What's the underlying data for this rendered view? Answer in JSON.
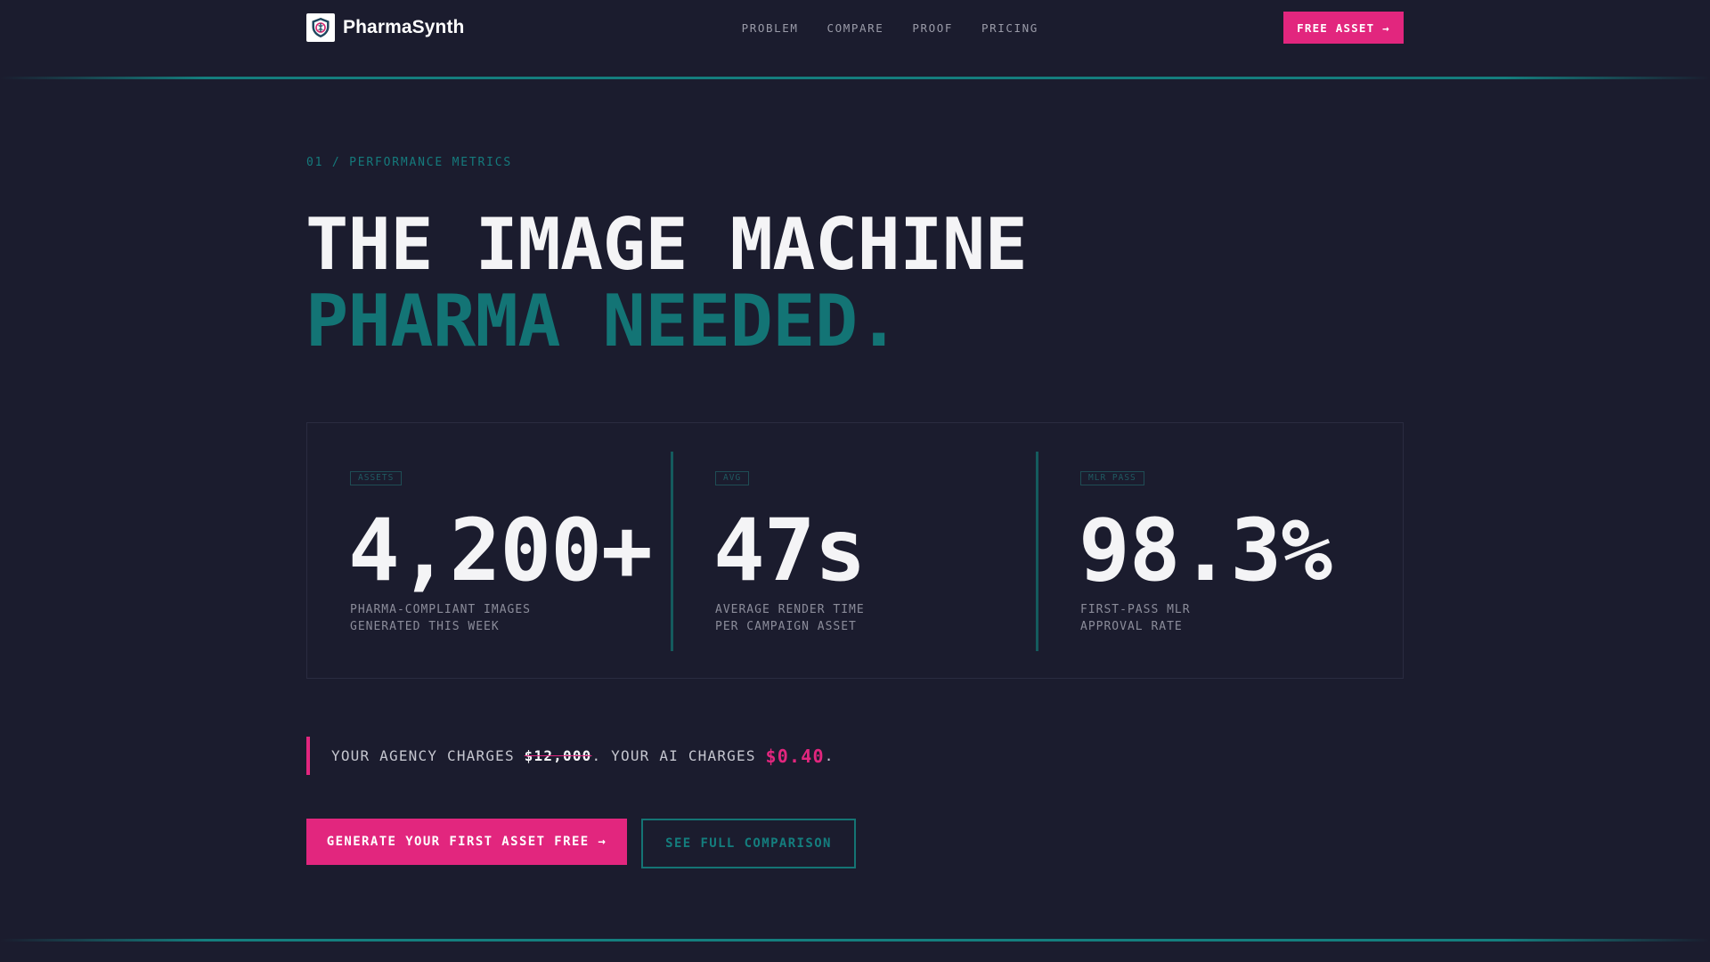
{
  "header": {
    "brand_name": "PharmaSynth",
    "logo_icon": "shield-caduceus-icon",
    "nav": [
      {
        "label": "PROBLEM"
      },
      {
        "label": "COMPARE"
      },
      {
        "label": "PROOF"
      },
      {
        "label": "PRICING"
      }
    ],
    "cta_label": "FREE ASSET →"
  },
  "hero": {
    "eyebrow": "01 / PERFORMANCE METRICS",
    "headline_line1": "THE IMAGE MACHINE",
    "headline_line2": "PHARMA NEEDED."
  },
  "stats": [
    {
      "tag": "ASSETS",
      "value": "4,200+",
      "desc_line1": "PHARMA-COMPLIANT IMAGES",
      "desc_line2": "GENERATED THIS WEEK"
    },
    {
      "tag": "AVG",
      "value": "47s",
      "desc_line1": "AVERAGE RENDER TIME",
      "desc_line2": "PER CAMPAIGN ASSET"
    },
    {
      "tag": "MLR PASS",
      "value": "98.3%",
      "desc_line1": "FIRST-PASS MLR",
      "desc_line2": "APPROVAL RATE"
    }
  ],
  "comparison": {
    "prefix": "YOUR AGENCY CHARGES ",
    "agency_price": "$12,000",
    "middle": ". YOUR AI CHARGES ",
    "ai_price": "$0.40",
    "suffix": "."
  },
  "ctas": {
    "primary": "GENERATE YOUR FIRST ASSET FREE →",
    "secondary": "SEE FULL COMPARISON"
  },
  "colors": {
    "background": "#1b1c2e",
    "accent_pink": "#e2267e",
    "accent_teal": "#137475"
  }
}
